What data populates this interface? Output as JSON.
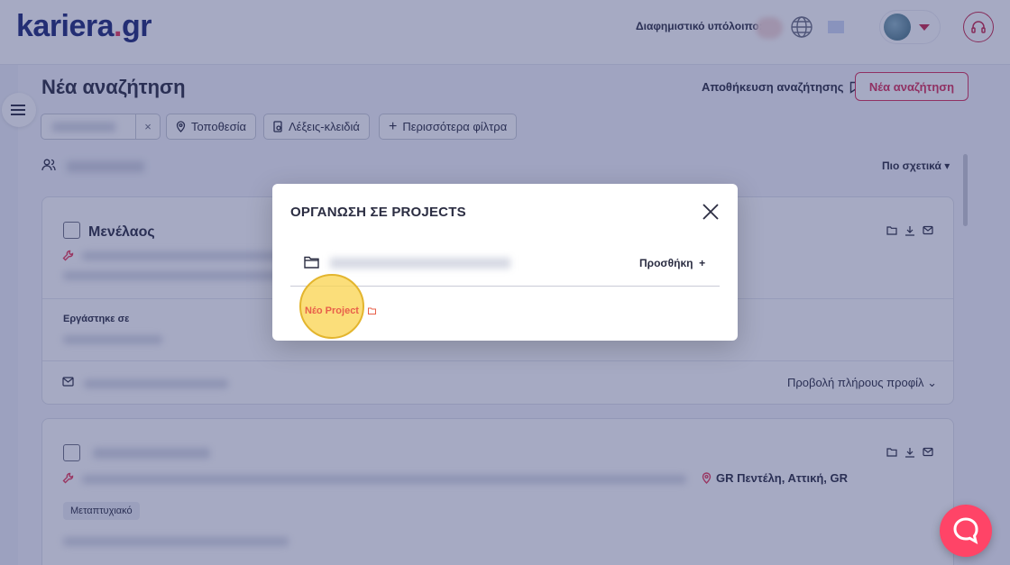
{
  "header": {
    "logo_main": "kariera",
    "logo_dot": ".",
    "logo_tld": "gr",
    "credit_label": "Διαφημιστικό υπόλοιπο:"
  },
  "search": {
    "title": "Νέα αναζήτηση",
    "save_label": "Αποθήκευση αναζήτησης",
    "new_search_label": "Νέα αναζήτηση",
    "clear_symbol": "×",
    "filters": [
      "Τοποθεσία",
      "Λέξεις-κλειδιά",
      "Περισσότερα φίλτρα"
    ],
    "sort_label": "Πιο σχετικά"
  },
  "cards": [
    {
      "name": "Μενέλαος",
      "worked_label": "Εργάστηκε σε",
      "view_profile_label": "Προβολή πλήρους προφίλ"
    },
    {
      "location": "GR Πεντέλη, Αττική, GR",
      "tag": "Μεταπτυχιακό"
    }
  ],
  "modal": {
    "title": "ΟΡΓΑΝΩΣΗ ΣΕ PROJECTS",
    "add_label": "Προσθήκη",
    "add_symbol": "+",
    "new_project_label": "Νέο Project"
  },
  "colors": {
    "brand_navy": "#1e2a78",
    "brand_red": "#d9305a",
    "highlight": "#fad554",
    "new_project": "#e8604a"
  }
}
